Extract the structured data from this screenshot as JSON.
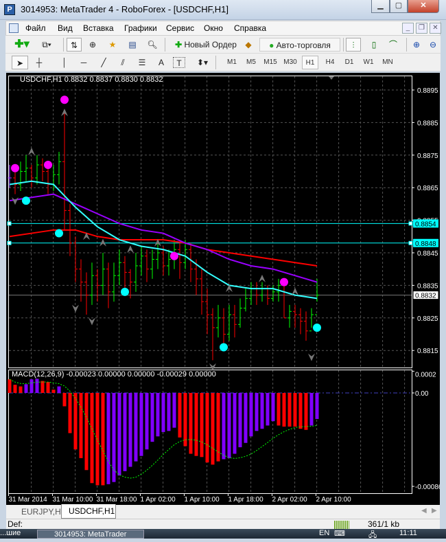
{
  "window": {
    "title": "3014953: MetaTrader 4 - RoboForex - [USDCHF,H1]",
    "app_icon": "metatrader-icon",
    "controls": [
      "minimize",
      "maximize",
      "close"
    ]
  },
  "menu": {
    "items": [
      "Файл",
      "Вид",
      "Вставка",
      "Графики",
      "Сервис",
      "Окно",
      "Справка"
    ]
  },
  "toolbar": {
    "new_order": "Новый Ордер",
    "autotrading": "Авто-торговля"
  },
  "timeframes": {
    "items": [
      "M1",
      "M5",
      "M15",
      "M30",
      "H1",
      "H4",
      "D1",
      "W1",
      "MN"
    ],
    "active": "H1"
  },
  "draw_tools": {
    "text_tool": "A",
    "label_tool": "T"
  },
  "chart": {
    "header": "USDCHF,H1  0.8832 0.8837 0.8830 0.8832",
    "price_labels": [
      "0.8895",
      "0.8885",
      "0.8875",
      "0.8865",
      "0.8855",
      "0.8845",
      "0.8835",
      "0.8825",
      "0.8815"
    ],
    "hlines": [
      {
        "price": 0.8854,
        "label": "0.8854",
        "color": "#00ffff"
      },
      {
        "price": 0.8848,
        "label": "0.8848",
        "color": "#00ffff"
      }
    ],
    "bid": {
      "price": 0.8832,
      "label": "0.8832"
    },
    "macd_header": "MACD(12,26,9) -0.00023 0.00000 0.00000 -0.00029 0.00000",
    "macd_labels": [
      "0.0002",
      "0.00",
      "-0.00086"
    ],
    "time_labels": [
      "31 Mar 2014",
      "31 Mar 10:00",
      "31 Mar 18:00",
      "1 Apr 02:00",
      "1 Apr 10:00",
      "1 Apr 18:00",
      "2 Apr 02:00",
      "2 Apr 10:00"
    ],
    "colors": {
      "up": "#00ff00",
      "down": "#ff0000",
      "neutral": "#9933ff",
      "ma_fast": "#33ffff",
      "ma_mid": "#9900ff",
      "ma_slow": "#ff0000",
      "macd_pos": "#ff0000",
      "macd_neg": "#8000ff",
      "signal": "#00ff00"
    }
  },
  "chart_data": {
    "type": "ohlc",
    "symbol": "USDCHF",
    "timeframe": "H1",
    "ylim": [
      0.881,
      0.8898
    ],
    "close": [
      0.8868,
      0.8866,
      0.887,
      0.8871,
      0.8868,
      0.8872,
      0.887,
      0.8866,
      0.8869,
      0.8873,
      0.8858,
      0.8848,
      0.884,
      0.8836,
      0.8832,
      0.8838,
      0.8835,
      0.884,
      0.8833,
      0.8838,
      0.8842,
      0.8839,
      0.8836,
      0.8841,
      0.8844,
      0.884,
      0.8843,
      0.8845,
      0.8841,
      0.8843,
      0.8846,
      0.8842,
      0.8846,
      0.884,
      0.8837,
      0.883,
      0.8826,
      0.8822,
      0.8825,
      0.882,
      0.8826,
      0.8823,
      0.8828,
      0.8831,
      0.8834,
      0.8832,
      0.8834,
      0.8831,
      0.8833,
      0.8835,
      0.8825,
      0.8827,
      0.8826,
      0.8824,
      0.8821,
      0.8826,
      0.8832
    ],
    "high": [
      0.8872,
      0.887,
      0.8873,
      0.8875,
      0.8872,
      0.8875,
      0.8874,
      0.8871,
      0.8872,
      0.8876,
      0.8888,
      0.886,
      0.885,
      0.8843,
      0.8839,
      0.8842,
      0.884,
      0.8845,
      0.8842,
      0.8842,
      0.8846,
      0.8844,
      0.884,
      0.8845,
      0.8847,
      0.8846,
      0.8846,
      0.8848,
      0.8847,
      0.8846,
      0.8849,
      0.8848,
      0.8849,
      0.8848,
      0.8843,
      0.884,
      0.8834,
      0.8828,
      0.8829,
      0.8828,
      0.8829,
      0.8829,
      0.8831,
      0.8834,
      0.8836,
      0.8836,
      0.8836,
      0.8835,
      0.8835,
      0.8837,
      0.8836,
      0.8829,
      0.8829,
      0.8828,
      0.8827,
      0.8828,
      0.8837
    ],
    "low": [
      0.8865,
      0.8863,
      0.8864,
      0.8867,
      0.8865,
      0.8866,
      0.8867,
      0.8863,
      0.8864,
      0.8866,
      0.8852,
      0.8844,
      0.8836,
      0.883,
      0.8826,
      0.8829,
      0.883,
      0.8832,
      0.8828,
      0.883,
      0.8835,
      0.8834,
      0.8831,
      0.8833,
      0.8838,
      0.8836,
      0.8837,
      0.884,
      0.8838,
      0.8838,
      0.884,
      0.8837,
      0.884,
      0.8836,
      0.8832,
      0.8826,
      0.882,
      0.8812,
      0.8819,
      0.8816,
      0.8818,
      0.8819,
      0.8822,
      0.8827,
      0.8829,
      0.8829,
      0.883,
      0.8829,
      0.883,
      0.883,
      0.8825,
      0.8822,
      0.8822,
      0.882,
      0.8818,
      0.8822,
      0.883
    ],
    "ma_every_4_bars": {
      "fast": [
        0.8866,
        0.8867,
        0.8866,
        0.8859,
        0.8853,
        0.8849,
        0.8847,
        0.8846,
        0.8844,
        0.8839,
        0.8835,
        0.8834,
        0.8834,
        0.8832,
        0.8831
      ],
      "mid": [
        0.8861,
        0.8862,
        0.8863,
        0.886,
        0.8857,
        0.8854,
        0.8852,
        0.8851,
        0.8848,
        0.8846,
        0.8843,
        0.8841,
        0.884,
        0.8838,
        0.8836
      ],
      "slow": [
        0.885,
        0.8851,
        0.8852,
        0.8852,
        0.885,
        0.8849,
        0.8849,
        0.8849,
        0.8848,
        0.8846,
        0.8845,
        0.8844,
        0.8843,
        0.8842,
        0.8841
      ]
    },
    "dots_magenta": [
      [
        1,
        0.8871
      ],
      [
        7,
        0.8872
      ],
      [
        10,
        0.8892
      ],
      [
        30,
        0.8844
      ],
      [
        50,
        0.8836
      ]
    ],
    "dots_cyan": [
      [
        3,
        0.8861
      ],
      [
        9,
        0.8851
      ],
      [
        21,
        0.8833
      ],
      [
        39,
        0.8816
      ],
      [
        56,
        0.8822
      ]
    ],
    "arrows_up": [
      [
        4,
        0.8876
      ],
      [
        10,
        0.8888
      ],
      [
        14,
        0.885
      ],
      [
        17,
        0.8848
      ],
      [
        22,
        0.8846
      ],
      [
        27,
        0.8848
      ],
      [
        40,
        0.8834
      ],
      [
        46,
        0.8837
      ],
      [
        52,
        0.8833
      ]
    ],
    "arrows_down": [
      [
        1,
        0.8861
      ],
      [
        12,
        0.8828
      ],
      [
        15,
        0.8824
      ],
      [
        37,
        0.881
      ],
      [
        55,
        0.8813
      ]
    ],
    "macd_hist": [
      0.000125,
      7.5e-05,
      6e-05,
      8e-05,
      0.000125,
      0.00013,
      0.00011,
      0.0001,
      3e-05,
      6e-05,
      -0.000123,
      -0.00037,
      -0.00052,
      -0.0006,
      -0.00071,
      -0.00083,
      -0.00085,
      -0.00085,
      -0.00084,
      -0.00082,
      -0.00076,
      -0.00072,
      -0.00068,
      -0.00063,
      -0.00058,
      -0.00052,
      -0.00045,
      -0.0004,
      -0.00036,
      -0.00035,
      -0.00032,
      -0.00041,
      -0.00049,
      -0.00056,
      -0.00058,
      -0.00059,
      -0.00064,
      -0.00066,
      -0.00063,
      -0.00061,
      -0.0006,
      -0.00056,
      -0.0005,
      -0.00046,
      -0.0004,
      -0.00035,
      -0.00033,
      -0.0003,
      -0.00026,
      -0.0003,
      -0.00031,
      -0.00031,
      -0.00031,
      -0.00033,
      -0.00034,
      -0.0003,
      -0.00024
    ],
    "macd_hist_color": [
      "r",
      "r",
      "r",
      "p",
      "p",
      "p",
      "r",
      "r",
      "r",
      "p",
      "r",
      "r",
      "r",
      "r",
      "r",
      "r",
      "r",
      "r",
      "p",
      "p",
      "p",
      "p",
      "p",
      "p",
      "p",
      "p",
      "p",
      "p",
      "p",
      "p",
      "p",
      "r",
      "r",
      "r",
      "r",
      "r",
      "r",
      "r",
      "r",
      "p",
      "p",
      "p",
      "p",
      "p",
      "p",
      "p",
      "p",
      "p",
      "p",
      "r",
      "r",
      "r",
      "r",
      "r",
      "r",
      "p",
      "p"
    ]
  },
  "tabs": [
    {
      "label": "EURJPY,H1"
    },
    {
      "label": "USDCHF,H1",
      "active": true
    }
  ],
  "status": {
    "profile": "Def:",
    "traffic": "361/1 kb"
  },
  "taskbar": {
    "left": "...шие",
    "task": "3014953: MetaTrader",
    "lang": "EN",
    "clock": "11:11"
  }
}
